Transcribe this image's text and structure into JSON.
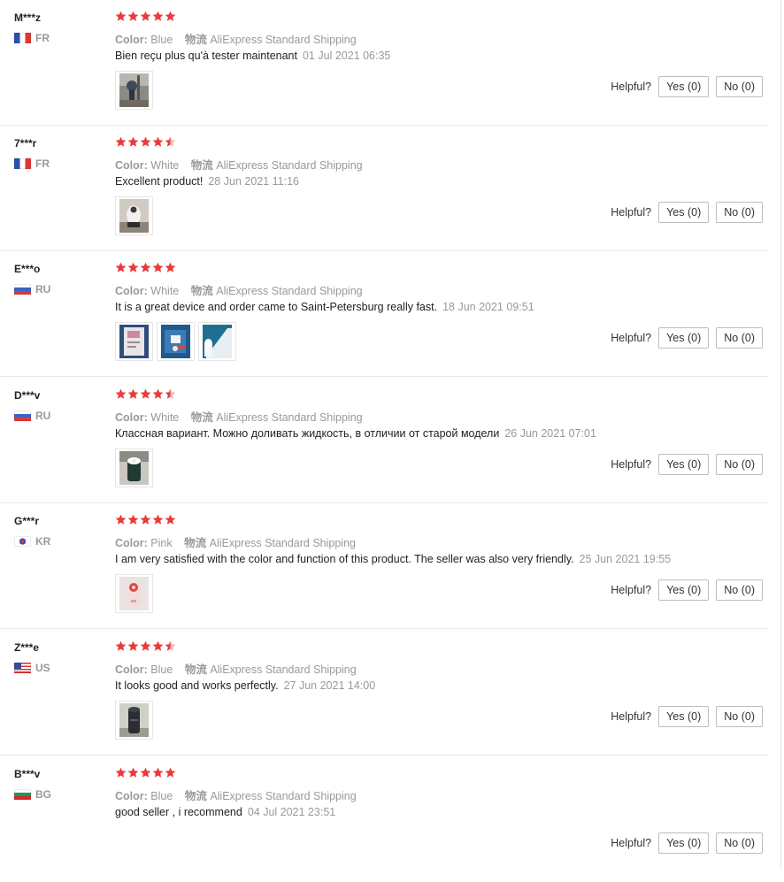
{
  "colors": {
    "star": "#e93b3d",
    "muted": "#999999",
    "text": "#222222"
  },
  "labels": {
    "color_key": "Color:",
    "shipping_key": "物流",
    "helpful": "Helpful?"
  },
  "reviews": [
    {
      "user": "M***z",
      "country": "FR",
      "flag": "fr",
      "stars": 5,
      "color": "Blue",
      "shipping": "AliExpress Standard Shipping",
      "text": "Bien reçu plus qu'à tester maintenant",
      "date": "01 Jul 2021 06:35",
      "photos": [
        "photo-device-on-stand"
      ],
      "yes": "Yes (0)",
      "no": "No (0)"
    },
    {
      "user": "7***r",
      "country": "FR",
      "flag": "fr",
      "stars": 4.5,
      "color": "White",
      "shipping": "AliExpress Standard Shipping",
      "text": "Excellent product!",
      "date": "28 Jun 2021 11:16",
      "photos": [
        "photo-white-device"
      ],
      "yes": "Yes (0)",
      "no": "No (0)"
    },
    {
      "user": "E***o",
      "country": "RU",
      "flag": "ru",
      "stars": 5,
      "color": "White",
      "shipping": "AliExpress Standard Shipping",
      "text": "It is a great device and order came to Saint-Petersburg really fast.",
      "date": "18 Jun 2021 09:51",
      "photos": [
        "photo-box",
        "photo-unboxing",
        "photo-device-blue"
      ],
      "yes": "Yes (0)",
      "no": "No (0)"
    },
    {
      "user": "D***v",
      "country": "RU",
      "flag": "ru",
      "stars": 4.5,
      "color": "White",
      "shipping": "AliExpress Standard Shipping",
      "text": "Классная вариант. Можно доливать жидкость, в отличии от старой модели",
      "date": "26 Jun 2021 07:01",
      "photos": [
        "photo-green-device"
      ],
      "yes": "Yes (0)",
      "no": "No (0)"
    },
    {
      "user": "G***r",
      "country": "KR",
      "flag": "kr",
      "stars": 5,
      "color": "Pink",
      "shipping": "AliExpress Standard Shipping",
      "text": "I am very satisfied with the color and function of this product. The seller was also very friendly.",
      "date": "25 Jun 2021 19:55",
      "photos": [
        "photo-pink-device"
      ],
      "yes": "Yes (0)",
      "no": "No (0)"
    },
    {
      "user": "Z***e",
      "country": "US",
      "flag": "us",
      "stars": 4.5,
      "color": "Blue",
      "shipping": "AliExpress Standard Shipping",
      "text": "It looks good and works perfectly.",
      "date": "27 Jun 2021 14:00",
      "photos": [
        "photo-dark-device"
      ],
      "yes": "Yes (0)",
      "no": "No (0)"
    },
    {
      "user": "B***v",
      "country": "BG",
      "flag": "bg",
      "stars": 5,
      "color": "Blue",
      "shipping": "AliExpress Standard Shipping",
      "text": "good seller , i recommend",
      "date": "04 Jul 2021 23:51",
      "photos": [],
      "yes": "Yes (0)",
      "no": "No (0)"
    }
  ]
}
